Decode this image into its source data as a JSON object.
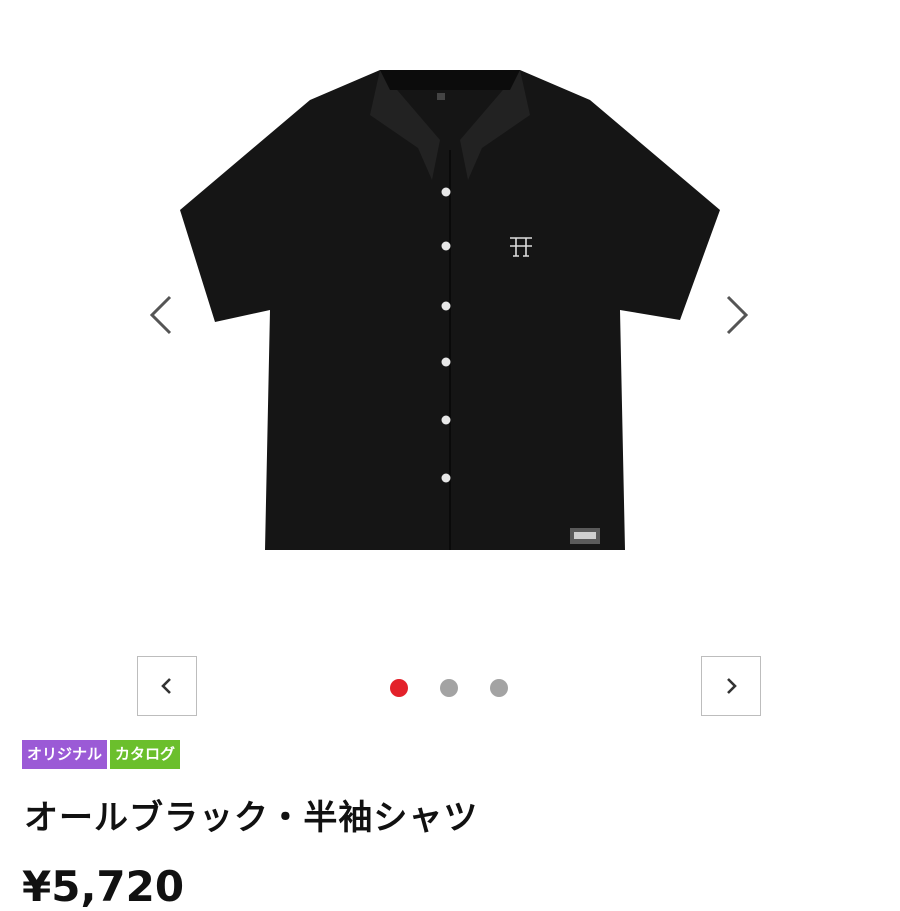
{
  "gallery": {
    "image_alt": "black short-sleeve shirt",
    "prev_arrow_icon": "chevron-left-icon",
    "next_arrow_icon": "chevron-right-icon",
    "slide_count": 3,
    "active_slide": 1,
    "active_dot_color": "#e3212a",
    "inactive_dot_color": "#a3a3a3"
  },
  "product": {
    "badges": [
      {
        "label": "オリジナル",
        "color": "#9b5ad6"
      },
      {
        "label": "カタログ",
        "color": "#6bbf2c"
      }
    ],
    "title": "オールブラック・半袖シャツ",
    "price": "¥5,720"
  }
}
